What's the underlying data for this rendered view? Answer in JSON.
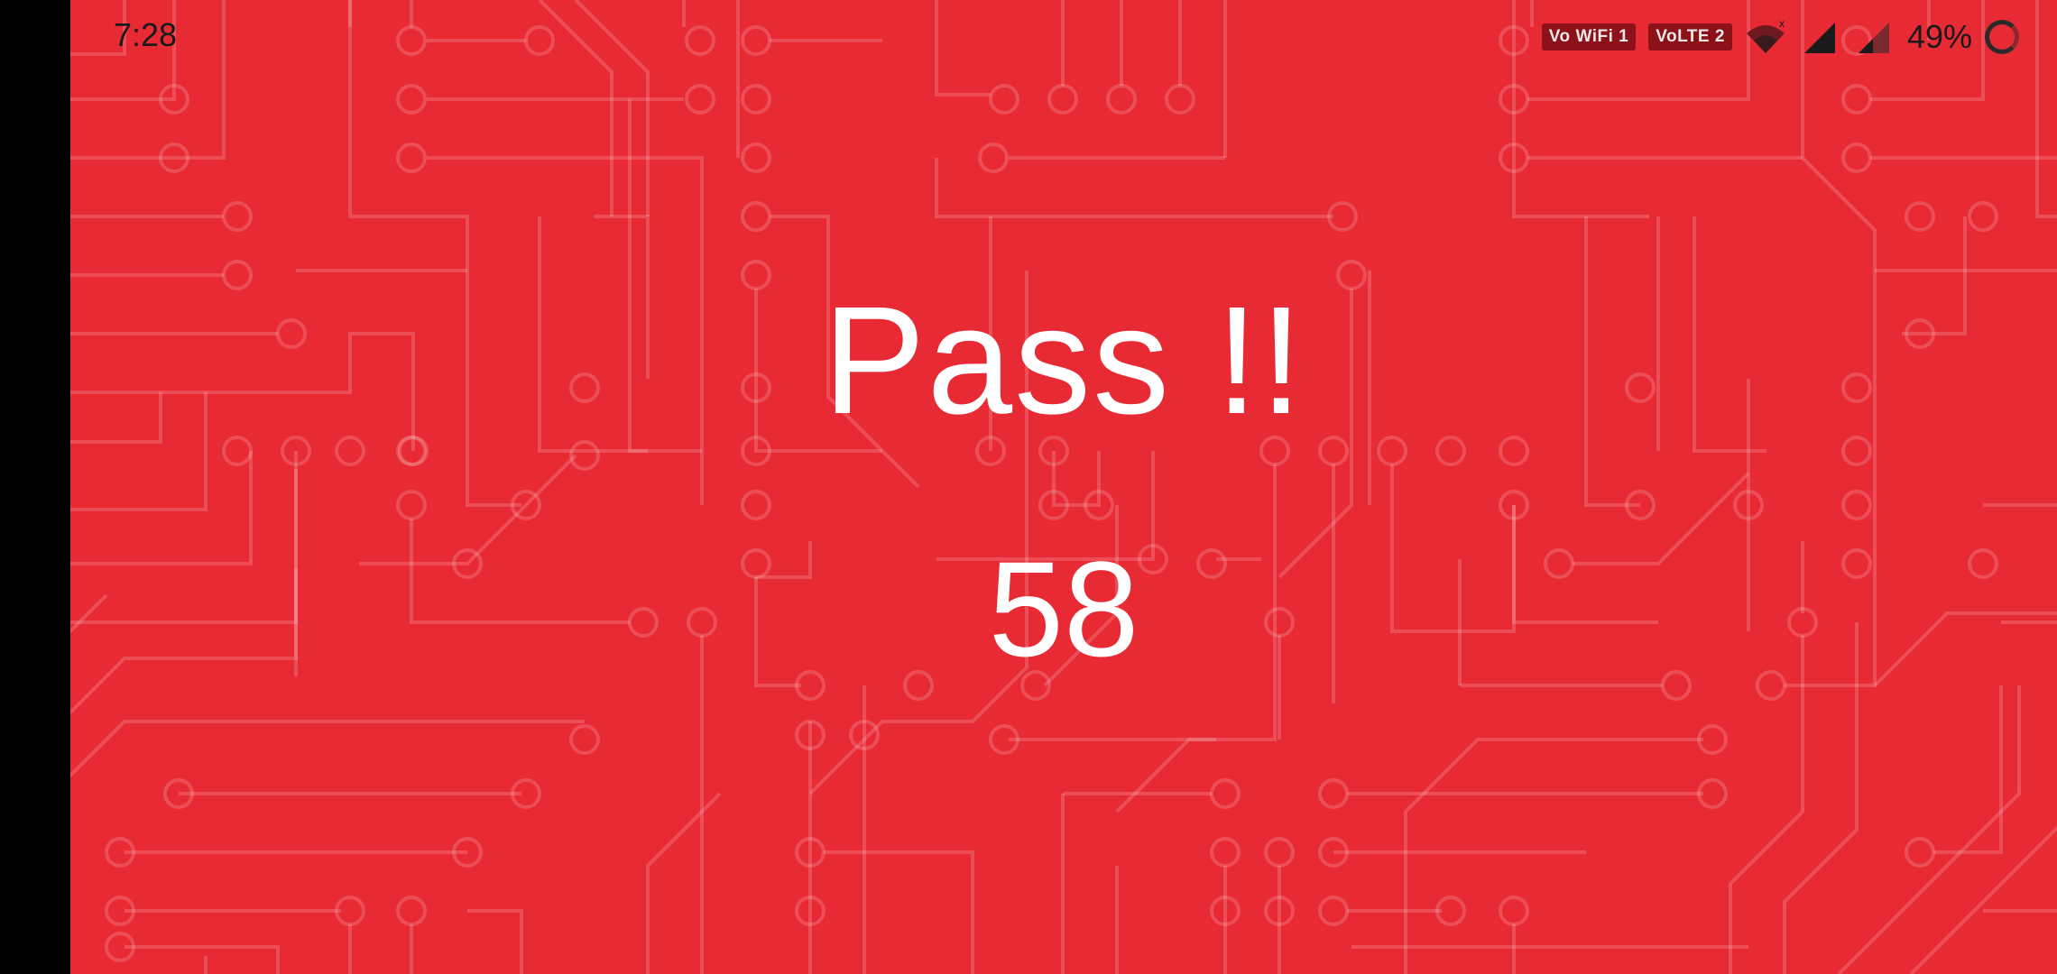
{
  "status_bar": {
    "time": "7:28",
    "badge_wifi": "Vo WiFi 1",
    "badge_lte": "VoLTE 2",
    "wifi_icon": "wifi-icon",
    "signal_icon_1": "cell-signal-icon",
    "signal_icon_2": "cell-signal-weak-icon",
    "battery_percent": "49%",
    "battery_icon": "battery-ring-icon"
  },
  "result": {
    "title": "Pass !!",
    "score": "58"
  },
  "colors": {
    "background": "#E82A34",
    "text": "#FFFFFF"
  }
}
